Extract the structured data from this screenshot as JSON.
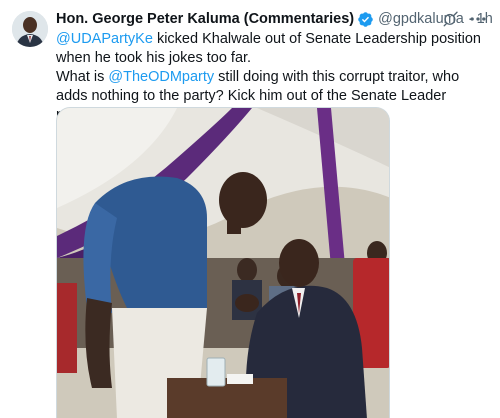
{
  "author": {
    "display_name": "Hon. George Peter Kaluma (Commentaries)",
    "handle": "@gpdkaluma",
    "separator": "·",
    "time": "1h",
    "verified": true
  },
  "tweet": {
    "line1_mention": "@UDAPartyKe",
    "line1_text": " kicked Khalwale out of Senate Leadership position when he took his jokes too far.",
    "line2_prefix": "What is ",
    "line2_mention": "@TheODMparty",
    "line2_text": " still doing with this corrupt traitor, who adds nothing to the party? Kick him out of the Senate Leader position he holds!"
  },
  "icons": {
    "verified": "verified-badge-icon",
    "grok": "grok-icon",
    "more": "more-options-icon"
  },
  "colors": {
    "link": "#1d9bf0",
    "verified": "#1d9bf0",
    "secondary_text": "#536471"
  }
}
